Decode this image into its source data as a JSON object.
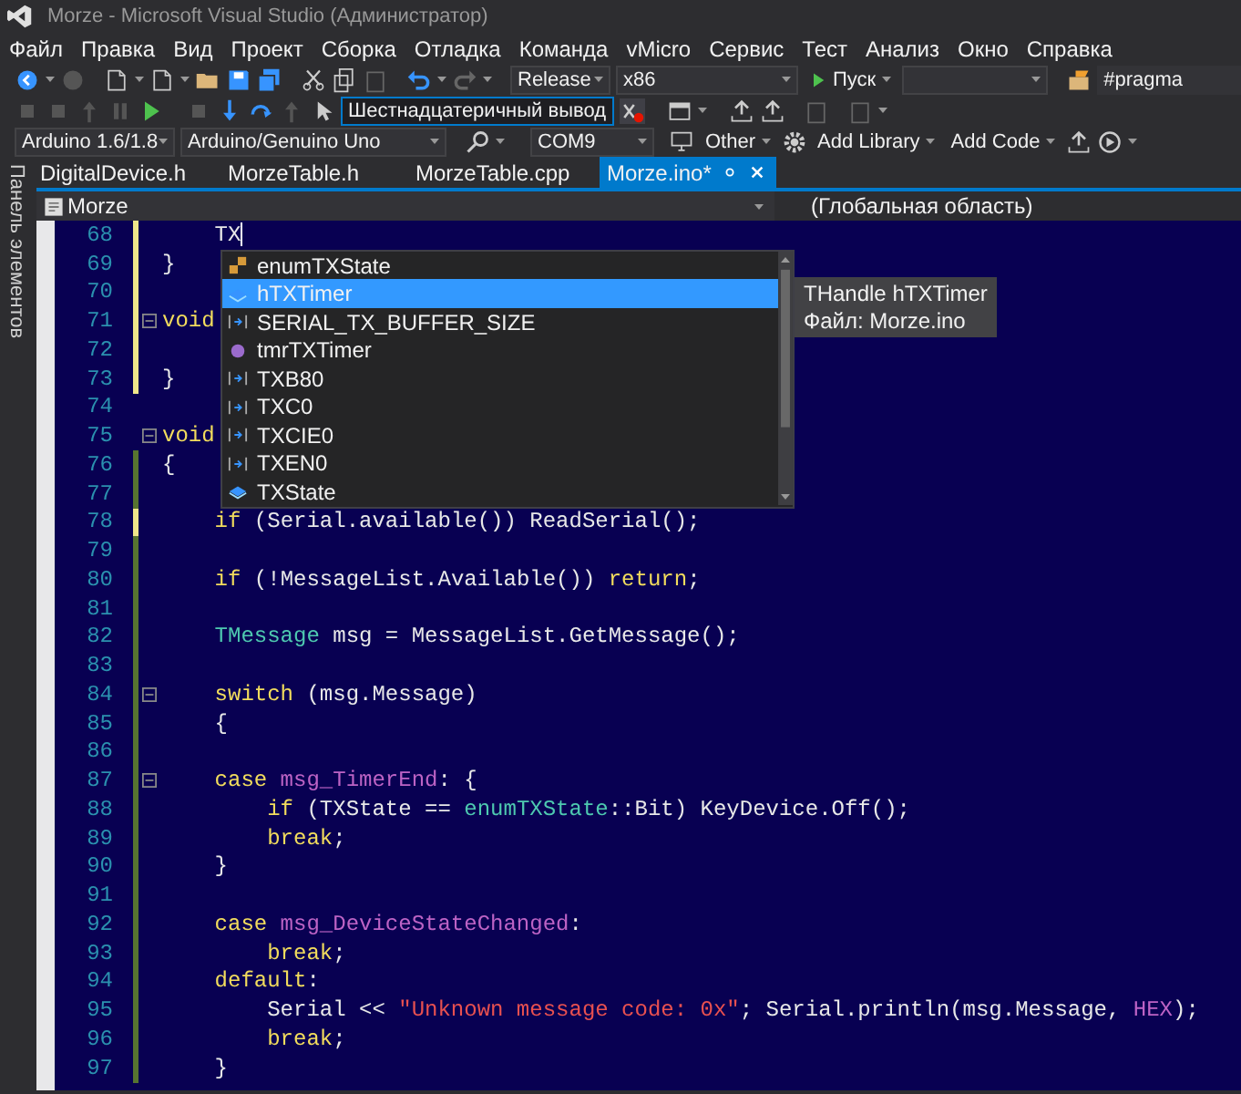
{
  "window": {
    "title": "Morze - Microsoft Visual Studio (Администратор)"
  },
  "menu": [
    "Файл",
    "Правка",
    "Вид",
    "Проект",
    "Сборка",
    "Отладка",
    "Команда",
    "vMicro",
    "Сервис",
    "Тест",
    "Анализ",
    "Окно",
    "Справка"
  ],
  "toolbar_1": {
    "configuration": "Release",
    "platform": "x86",
    "start": "Пуск",
    "find": "#pragma"
  },
  "toolbar_2": {
    "watch_field": "Шестнадцатеричный вывод"
  },
  "toolbar_3": {
    "board_version": "Arduino 1.6/1.8",
    "board": "Arduino/Genuino Uno",
    "port": "COM9",
    "other": "Other",
    "add_library": "Add Library",
    "add_code": "Add Code"
  },
  "side_panel": {
    "label": "Панель элементов"
  },
  "tabs": [
    {
      "label": "DigitalDevice.h",
      "selected": false
    },
    {
      "label": "MorzeTable.h",
      "selected": false
    },
    {
      "label": "MorzeTable.cpp",
      "selected": false
    },
    {
      "label": "Morze.ino*",
      "selected": true
    }
  ],
  "navigation": {
    "scope": "Morze",
    "region": "(Глобальная область)"
  },
  "editor": {
    "lines": [
      {
        "number": "68",
        "unsaved": true,
        "saved": false,
        "fold": false,
        "cursor": true,
        "tokens": [
          {
            "t": "    TX",
            "kind": "plain"
          }
        ]
      },
      {
        "number": "69",
        "unsaved": true,
        "saved": false,
        "fold": false,
        "cursor": false,
        "tokens": [
          {
            "t": "}",
            "kind": "plain"
          }
        ]
      },
      {
        "number": "70",
        "unsaved": true,
        "saved": false,
        "fold": false,
        "cursor": false
      },
      {
        "number": "71",
        "unsaved": true,
        "saved": false,
        "fold": true,
        "cursor": false,
        "tokens": [
          {
            "t": "void",
            "kind": "kw"
          }
        ]
      },
      {
        "number": "72",
        "unsaved": true,
        "saved": false,
        "fold": false,
        "cursor": false
      },
      {
        "number": "73",
        "unsaved": true,
        "saved": false,
        "fold": false,
        "cursor": false,
        "tokens": [
          {
            "t": "}",
            "kind": "plain"
          }
        ]
      },
      {
        "number": "74",
        "unsaved": false,
        "saved": false,
        "fold": false,
        "cursor": false
      },
      {
        "number": "75",
        "unsaved": false,
        "saved": false,
        "fold": true,
        "cursor": false,
        "tokens": [
          {
            "t": "void",
            "kind": "kw"
          }
        ]
      },
      {
        "number": "76",
        "unsaved": false,
        "saved": true,
        "fold": false,
        "cursor": false,
        "tokens": [
          {
            "t": "{",
            "kind": "plain"
          }
        ]
      },
      {
        "number": "77",
        "unsaved": false,
        "saved": true,
        "fold": false,
        "cursor": false
      },
      {
        "number": "78",
        "unsaved": true,
        "saved": false,
        "fold": false,
        "cursor": false,
        "tokens": [
          {
            "t": "    if",
            "kind": "kw"
          },
          {
            "t": " (Serial.available()) ReadSerial();",
            "kind": "plain"
          }
        ]
      },
      {
        "number": "79",
        "unsaved": false,
        "saved": true,
        "fold": false,
        "cursor": false
      },
      {
        "number": "80",
        "unsaved": false,
        "saved": true,
        "fold": false,
        "cursor": false,
        "tokens": [
          {
            "t": "    if",
            "kind": "kw"
          },
          {
            "t": " (!MessageList.Available()) ",
            "kind": "plain"
          },
          {
            "t": "return",
            "kind": "kw"
          },
          {
            "t": ";",
            "kind": "plain"
          }
        ]
      },
      {
        "number": "81",
        "unsaved": false,
        "saved": true,
        "fold": false,
        "cursor": false
      },
      {
        "number": "82",
        "unsaved": false,
        "saved": true,
        "fold": false,
        "cursor": false,
        "tokens": [
          {
            "t": "    TMessage",
            "kind": "type"
          },
          {
            "t": " msg = MessageList.GetMessage();",
            "kind": "plain"
          }
        ]
      },
      {
        "number": "83",
        "unsaved": false,
        "saved": true,
        "fold": false,
        "cursor": false
      },
      {
        "number": "84",
        "unsaved": false,
        "saved": true,
        "fold": true,
        "cursor": false,
        "tokens": [
          {
            "t": "    switch",
            "kind": "kw"
          },
          {
            "t": " (msg.Message)",
            "kind": "plain"
          }
        ]
      },
      {
        "number": "85",
        "unsaved": false,
        "saved": true,
        "fold": false,
        "cursor": false,
        "tokens": [
          {
            "t": "    {",
            "kind": "plain"
          }
        ]
      },
      {
        "number": "86",
        "unsaved": false,
        "saved": true,
        "fold": false,
        "cursor": false
      },
      {
        "number": "87",
        "unsaved": false,
        "saved": true,
        "fold": true,
        "cursor": false,
        "tokens": [
          {
            "t": "    case",
            "kind": "kw"
          },
          {
            "t": " msg_TimerEnd",
            "kind": "macro"
          },
          {
            "t": ": {",
            "kind": "plain"
          }
        ]
      },
      {
        "number": "88",
        "unsaved": false,
        "saved": true,
        "fold": false,
        "cursor": false,
        "tokens": [
          {
            "t": "        if",
            "kind": "kw"
          },
          {
            "t": " (TXState == ",
            "kind": "plain"
          },
          {
            "t": "enumTXState",
            "kind": "type"
          },
          {
            "t": "::Bit) KeyDevice.Off();",
            "kind": "plain"
          }
        ]
      },
      {
        "number": "89",
        "unsaved": false,
        "saved": true,
        "fold": false,
        "cursor": false,
        "tokens": [
          {
            "t": "        break",
            "kind": "kw"
          },
          {
            "t": ";",
            "kind": "plain"
          }
        ]
      },
      {
        "number": "90",
        "unsaved": false,
        "saved": true,
        "fold": false,
        "cursor": false,
        "tokens": [
          {
            "t": "    }",
            "kind": "plain"
          }
        ]
      },
      {
        "number": "91",
        "unsaved": false,
        "saved": true,
        "fold": false,
        "cursor": false
      },
      {
        "number": "92",
        "unsaved": false,
        "saved": true,
        "fold": false,
        "cursor": false,
        "tokens": [
          {
            "t": "    case",
            "kind": "kw"
          },
          {
            "t": " msg_DeviceStateChanged",
            "kind": "macro"
          },
          {
            "t": ":",
            "kind": "plain"
          }
        ]
      },
      {
        "number": "93",
        "unsaved": false,
        "saved": true,
        "fold": false,
        "cursor": false,
        "tokens": [
          {
            "t": "        break",
            "kind": "kw"
          },
          {
            "t": ";",
            "kind": "plain"
          }
        ]
      },
      {
        "number": "94",
        "unsaved": false,
        "saved": true,
        "fold": false,
        "cursor": false,
        "tokens": [
          {
            "t": "    default",
            "kind": "kw"
          },
          {
            "t": ":",
            "kind": "plain"
          }
        ]
      },
      {
        "number": "95",
        "unsaved": false,
        "saved": true,
        "fold": false,
        "cursor": false,
        "tokens": [
          {
            "t": "        Serial << ",
            "kind": "plain"
          },
          {
            "t": "\"Unknown message code: 0x\"",
            "kind": "str"
          },
          {
            "t": "; Serial.println(msg.Message, ",
            "kind": "plain"
          },
          {
            "t": "HEX",
            "kind": "macro"
          },
          {
            "t": ");",
            "kind": "plain"
          }
        ]
      },
      {
        "number": "96",
        "unsaved": false,
        "saved": true,
        "fold": false,
        "cursor": false,
        "tokens": [
          {
            "t": "        break",
            "kind": "kw"
          },
          {
            "t": ";",
            "kind": "plain"
          }
        ]
      },
      {
        "number": "97",
        "unsaved": false,
        "saved": true,
        "fold": false,
        "cursor": false,
        "tokens": [
          {
            "t": "    }",
            "kind": "plain"
          }
        ]
      }
    ]
  },
  "completion": {
    "items": [
      {
        "label": "enumTXState",
        "kind": "enum",
        "selected": false
      },
      {
        "label": "hTXTimer",
        "kind": "field",
        "selected": true
      },
      {
        "label": "SERIAL_TX_BUFFER_SIZE",
        "kind": "macro",
        "selected": false
      },
      {
        "label": "tmrTXTimer",
        "kind": "variable",
        "selected": false
      },
      {
        "label": "TXB80",
        "kind": "macro",
        "selected": false
      },
      {
        "label": "TXC0",
        "kind": "macro",
        "selected": false
      },
      {
        "label": "TXCIE0",
        "kind": "macro",
        "selected": false
      },
      {
        "label": "TXEN0",
        "kind": "macro",
        "selected": false
      },
      {
        "label": "TXState",
        "kind": "field",
        "selected": false
      }
    ],
    "tooltip": [
      "THandle hTXTimer",
      "Файл: Morze.ino"
    ]
  }
}
